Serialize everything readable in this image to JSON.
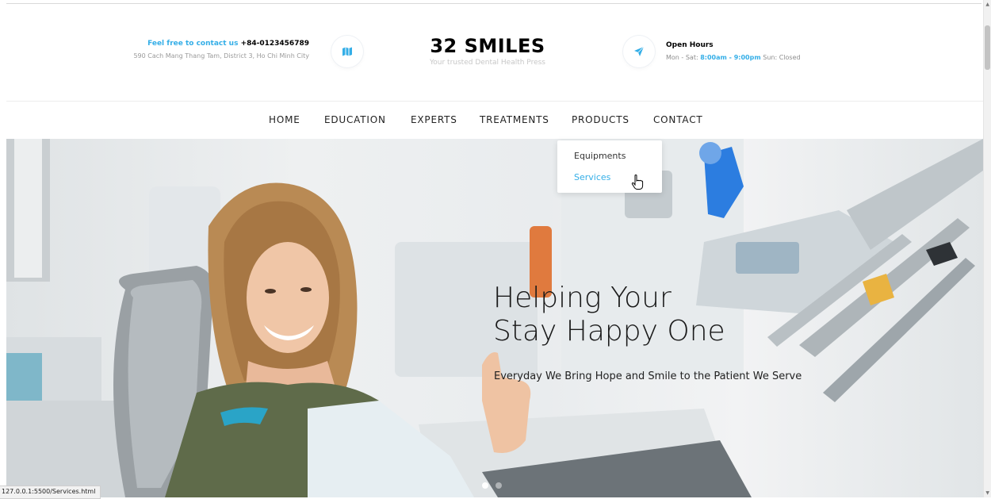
{
  "header": {
    "contact_prefix": "Feel free to contact us",
    "phone": "+84-0123456789",
    "address": "590 Cach Mang Thang Tam, District 3, Ho Chi Minh City",
    "brand_title": "32 SMILES",
    "brand_tagline": "Your trusted Dental Health Press",
    "hours_title": "Open Hours",
    "hours_prefix": "Mon - Sat:",
    "hours_time": "8:00am - 9:00pm",
    "hours_suffix": "Sun: Closed",
    "map_icon": "map-icon",
    "send_icon": "paper-plane-icon"
  },
  "nav": {
    "items": [
      "HOME",
      "EDUCATION",
      "EXPERTS",
      "TREATMENTS",
      "PRODUCTS",
      "CONTACT"
    ],
    "dropdown": [
      "Equipments",
      "Services"
    ],
    "dropdown_active": "Services"
  },
  "hero": {
    "heading_line1": "Helping Your",
    "heading_line2": "Stay Happy One",
    "subheading": "Everyday We Bring Hope and Smile to the Patient We Serve",
    "slide_count": 2,
    "active_slide": 1
  },
  "status_bar": "127.0.0.1:5500/Services.html",
  "colors": {
    "accent": "#34aee7",
    "text_dark": "#222222",
    "muted": "#9a9a9a"
  }
}
